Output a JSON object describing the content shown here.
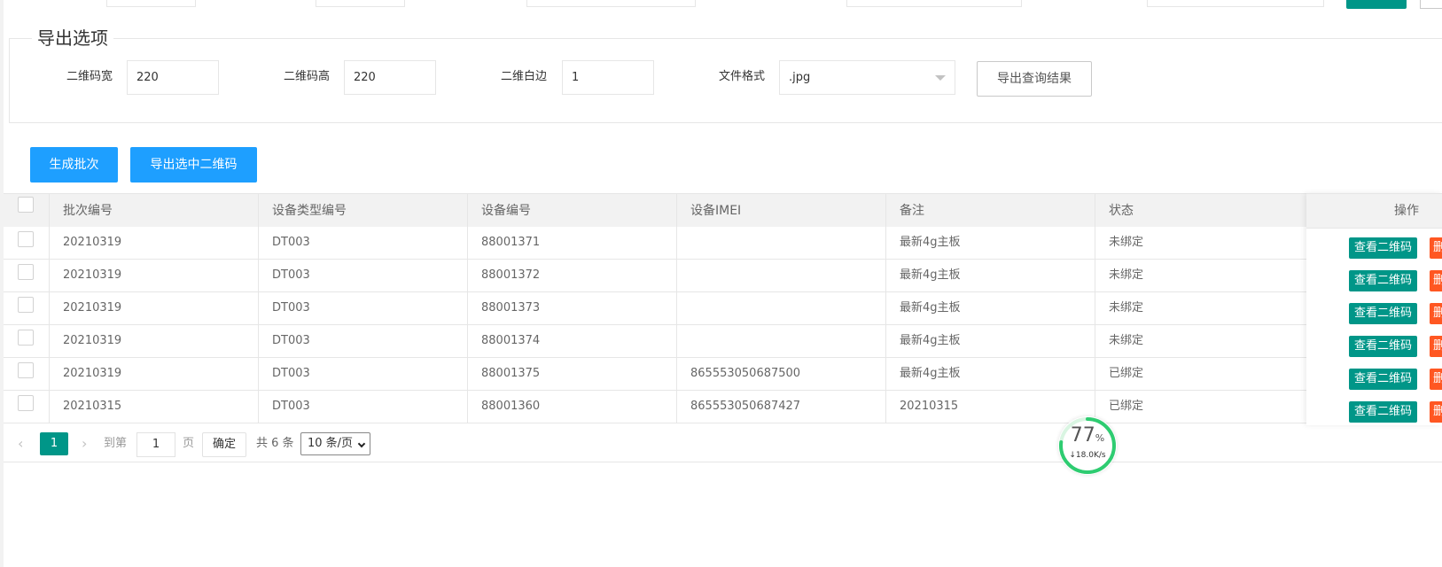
{
  "export_options": {
    "legend": "导出选项",
    "qr_width_label": "二维码宽",
    "qr_width_value": "220",
    "qr_height_label": "二维码高",
    "qr_height_value": "220",
    "qr_margin_label": "二维白边",
    "qr_margin_value": "1",
    "file_format_label": "文件格式",
    "file_format_value": ".jpg",
    "export_results_button": "导出查询结果"
  },
  "actions": {
    "generate_batch": "生成批次",
    "export_selected_qr": "导出选中二维码"
  },
  "table": {
    "headers": [
      "批次编号",
      "设备类型编号",
      "设备编号",
      "设备IMEI",
      "备注",
      "状态",
      "操作"
    ],
    "rows": [
      {
        "batch": "20210319",
        "type": "DT003",
        "device": "88001371",
        "imei": "",
        "note": "最新4g主板",
        "status": "未绑定"
      },
      {
        "batch": "20210319",
        "type": "DT003",
        "device": "88001372",
        "imei": "",
        "note": "最新4g主板",
        "status": "未绑定"
      },
      {
        "batch": "20210319",
        "type": "DT003",
        "device": "88001373",
        "imei": "",
        "note": "最新4g主板",
        "status": "未绑定"
      },
      {
        "batch": "20210319",
        "type": "DT003",
        "device": "88001374",
        "imei": "",
        "note": "最新4g主板",
        "status": "未绑定"
      },
      {
        "batch": "20210319",
        "type": "DT003",
        "device": "88001375",
        "imei": "865553050687500",
        "note": "最新4g主板",
        "status": "已绑定"
      },
      {
        "batch": "20210315",
        "type": "DT003",
        "device": "88001360",
        "imei": "865553050687427",
        "note": "20210315",
        "status": "已绑定"
      }
    ],
    "view_qr_label": "查看二维码",
    "delete_label": "删"
  },
  "pagination": {
    "current_page": "1",
    "goto_label": "到第",
    "goto_value": "1",
    "page_unit": "页",
    "confirm": "确定",
    "total": "共 6 条",
    "page_size": "10 条/页"
  },
  "speed_widget": {
    "percent": "77",
    "percent_unit": "%",
    "speed": "↓18.0K/s"
  },
  "colors": {
    "primary_blue": "#1e9fff",
    "teal": "#009688",
    "danger": "#ff5722"
  }
}
